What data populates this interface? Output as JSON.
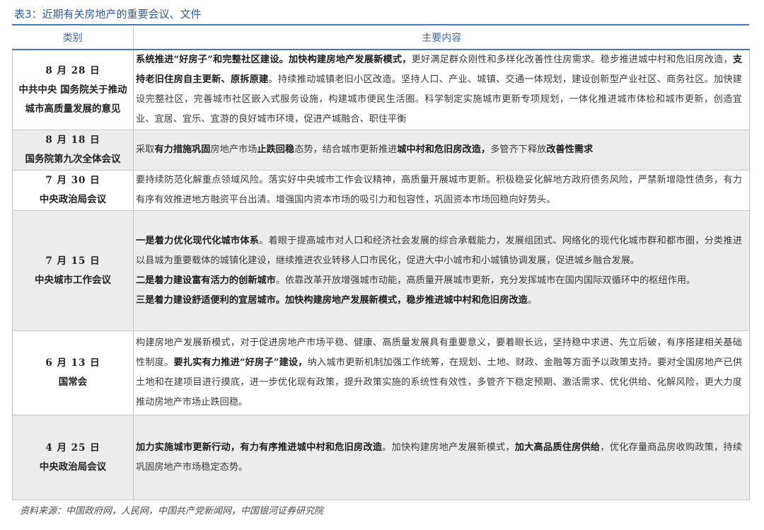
{
  "title": "表3：近期有关房地产的重要会议、文件",
  "headers": {
    "category": "类别",
    "content": "主要内容"
  },
  "rows": [
    {
      "date": "8 月 28 日",
      "name": "中共中央  国务院关于推动城市高质量发展的意见",
      "shaded": false,
      "segments": [
        {
          "t": "系统推进“好房子”和完整社区建设。加快构建房地产发展新模式，",
          "b": true
        },
        {
          "t": "更好满足群众刚性和多样化改善性住房需求。稳步推进城中村和危旧房改造，",
          "b": false
        },
        {
          "t": "支持老旧住房自主更新、原拆原建",
          "b": true
        },
        {
          "t": "。持续推动城镇老旧小区改造。坚持人口、产业、城镇、交通一体规划，建设创新型产业社区、商务社区。加快建设完整社区，完善城市社区嵌入式服务设施，构建城市便民生活圈。科学制定实施城市更新专项规划，一体化推进城市体检和城市更新，创造宜业、宜居、宜乐、宜游的良好城市环境，促进产城融合、职住平衡",
          "b": false
        }
      ]
    },
    {
      "date": "8 月 18 日",
      "name": "国务院第九次全体会议",
      "shaded": true,
      "segments": [
        {
          "t": "采取",
          "b": false
        },
        {
          "t": "有力措施巩固",
          "b": true
        },
        {
          "t": "房地产市场",
          "b": false
        },
        {
          "t": "止跌回稳",
          "b": true
        },
        {
          "t": "态势，",
          "b": false
        },
        {
          "t": "结合城市更新推进",
          "b": false
        },
        {
          "t": "城中村和危旧房改造，",
          "b": true
        },
        {
          "t": "多管齐下释放",
          "b": false
        },
        {
          "t": "改善性需求",
          "b": true
        }
      ]
    },
    {
      "date": "7 月 30 日",
      "name": "中央政治局会议",
      "shaded": false,
      "segments": [
        {
          "t": "要持续防范化解重点领域风险。落实好中央城市工作会议精神，高质量开展城市更新。积极稳妥化解地方政府债务风险，严禁新增隐性债务，有力有序有效推进地方融资平台出清。增强国内资本市场的吸引力和包容性，巩固资本市场回稳向好势头。",
          "b": false
        }
      ]
    },
    {
      "date": "7 月 15 日",
      "name": "中央城市工作会议",
      "shaded": true,
      "paragraphs": [
        [
          {
            "t": "一是着力优化现代化城市体系",
            "b": true
          },
          {
            "t": "。着眼于提高城市对人口和经济社会发展的综合承载能力，发展组团式、网络化的现代化城市群和都市圈，分类推进以县城为重要载体的城镇化建设，继续推进农业转移人口市民化，促进大中小城市和小城镇协调发展，促进城乡融合发展。",
            "b": false
          }
        ],
        [
          {
            "t": "二是着力建设富有活力的创新城市",
            "b": true
          },
          {
            "t": "。依靠改革开放增强城市动能，高质量开展城市更新，充分发挥城市在国内国际双循环中的枢纽作用。",
            "b": false
          }
        ],
        [
          {
            "t": "三是着力建设舒适便利的宜居城市。加快构建房地产发展新模式，稳步推进城中村和危旧房改造",
            "b": true
          },
          {
            "t": "。",
            "b": false
          }
        ]
      ]
    },
    {
      "date": "6 月 13 日",
      "name": "国常会",
      "shaded": false,
      "segments": [
        {
          "t": "构建房地产发展新模式，对于促进房地产市场平稳、健康、高质量发展具有重要意义，要着眼长远，坚持稳中求进、先立后破，有序搭建相关基础性制度。",
          "b": false
        },
        {
          "t": "要扎实有力推进“好房子”建设，",
          "b": true
        },
        {
          "t": "纳入城市更新机制加强工作统筹，在规划、土地、财政、金融等方面予以政策支持。要对全国房地产已供土地和在建项目进行摸底，进一步优化现有政策，提升政策实施的系统性有效性，多管齐下稳定预期、激活需求、优化供给、化解风险，更大力度推动房地产市场止跌回稳。",
          "b": false
        }
      ]
    },
    {
      "date": "4 月 25 日",
      "name": "中央政治局会议",
      "shaded": true,
      "segments": [
        {
          "t": "加力实施城市更新行动，有力有序推进城中村和危旧房改造",
          "b": true
        },
        {
          "t": "。加快构建房地产发展新模式，",
          "b": false
        },
        {
          "t": "加大高品质住房供给",
          "b": true
        },
        {
          "t": "，优化存量商品房收购政策，持续巩固房地产市场稳定态势。",
          "b": false
        }
      ]
    }
  ],
  "source": "资料来源：中国政府网，人民网，中国共产党新闻网，中国银河证券研究院"
}
